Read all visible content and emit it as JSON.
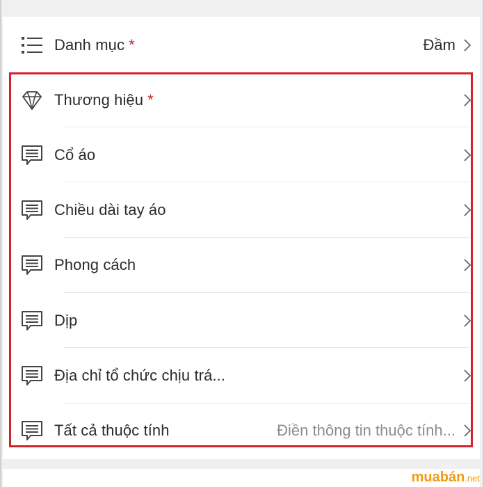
{
  "category_row": {
    "label": "Danh mục",
    "required_mark": "*",
    "value": "Đầm",
    "icon": "list-icon"
  },
  "attributes": [
    {
      "label": "Thương hiệu",
      "required_mark": "*",
      "value": "",
      "icon": "diamond-icon"
    },
    {
      "label": "Cổ áo",
      "required_mark": "",
      "value": "",
      "icon": "comment-icon"
    },
    {
      "label": "Chiều dài tay áo",
      "required_mark": "",
      "value": "",
      "icon": "comment-icon"
    },
    {
      "label": "Phong cách",
      "required_mark": "",
      "value": "",
      "icon": "comment-icon"
    },
    {
      "label": "Dịp",
      "required_mark": "",
      "value": "",
      "icon": "comment-icon"
    },
    {
      "label": "Địa chỉ tổ chức chịu trá...",
      "required_mark": "",
      "value": "",
      "icon": "comment-icon"
    },
    {
      "label": "Tất cả thuộc tính",
      "required_mark": "",
      "value": "Điền thông tin thuộc tính...",
      "icon": "comment-icon"
    }
  ],
  "colors": {
    "highlight": "#d2232a",
    "required": "#c2252e",
    "watermark": "#f29a12"
  },
  "watermark": {
    "main": "muabán",
    "suffix": ".net"
  }
}
